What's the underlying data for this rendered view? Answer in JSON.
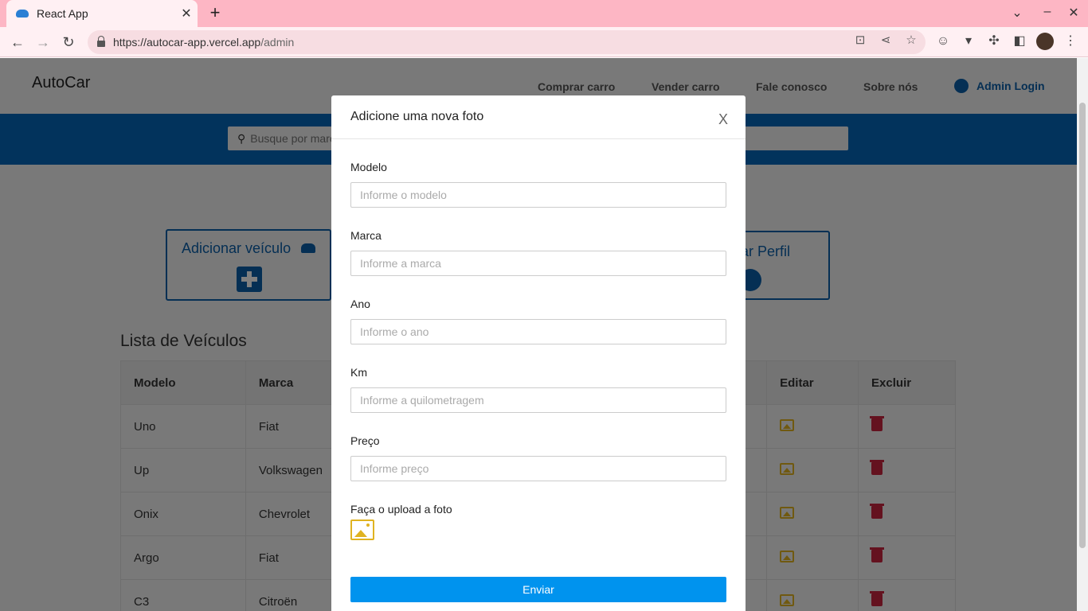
{
  "browser": {
    "tab_title": "React App",
    "url_host": "https://autocar-app.vercel.app",
    "url_path": "/admin"
  },
  "navbar": {
    "brand": "AutoCar",
    "links": [
      "Comprar carro",
      "Vender carro",
      "Fale conosco",
      "Sobre nós"
    ],
    "admin_login": "Admin Login"
  },
  "search": {
    "placeholder": "Busque por marca ou modelo"
  },
  "cards": {
    "add_vehicle": "Adicionar veículo",
    "edit_profile": "ar Perfil"
  },
  "vehicle_list": {
    "title": "Lista de Veículos",
    "headers": [
      "Modelo",
      "Marca",
      "Editar",
      "Excluir"
    ],
    "rows": [
      {
        "modelo": "Uno",
        "marca": "Fiat"
      },
      {
        "modelo": "Up",
        "marca": "Volkswagen"
      },
      {
        "modelo": "Onix",
        "marca": "Chevrolet"
      },
      {
        "modelo": "Argo",
        "marca": "Fiat"
      },
      {
        "modelo": "C3",
        "marca": "Citroën"
      }
    ]
  },
  "modal": {
    "title": "Adicione uma nova foto",
    "close": "X",
    "fields": [
      {
        "label": "Modelo",
        "placeholder": "Informe o modelo"
      },
      {
        "label": "Marca",
        "placeholder": "Informe a marca"
      },
      {
        "label": "Ano",
        "placeholder": "Informe o ano"
      },
      {
        "label": "Km",
        "placeholder": "Informe a quilometragem"
      },
      {
        "label": "Preço",
        "placeholder": "Informe preço"
      }
    ],
    "upload_label": "Faça o upload a foto",
    "submit": "Enviar"
  },
  "icons": {
    "edit": "image-icon",
    "delete": "trash-icon",
    "upload": "image-icon"
  },
  "colors": {
    "brand_blue": "#0567b9",
    "submit_blue": "#0093ee",
    "edit_yellow": "#e0b321",
    "delete_red": "#c8243f"
  }
}
